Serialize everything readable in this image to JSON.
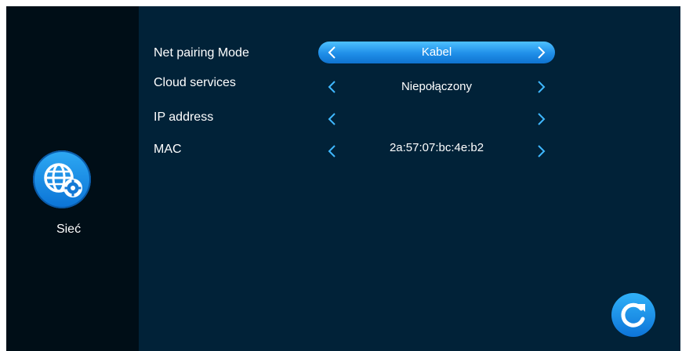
{
  "sidebar": {
    "label": "Sieć",
    "icon": "globe-gear-icon"
  },
  "settings": [
    {
      "label": "Net pairing Mode",
      "value": "Kabel",
      "active": true
    },
    {
      "label": "Cloud services",
      "value": "Niepołączony",
      "active": false
    },
    {
      "label": "IP address",
      "value": "",
      "active": false
    },
    {
      "label": "MAC",
      "value": "2a:57:07:bc:4e:b2",
      "active": false
    }
  ],
  "colors": {
    "background": "#012238",
    "sidebar": "#000e17",
    "accent": "#1f8ee8",
    "chevron": "#3fb8ff"
  },
  "actions": {
    "refresh_icon": "refresh-icon"
  }
}
